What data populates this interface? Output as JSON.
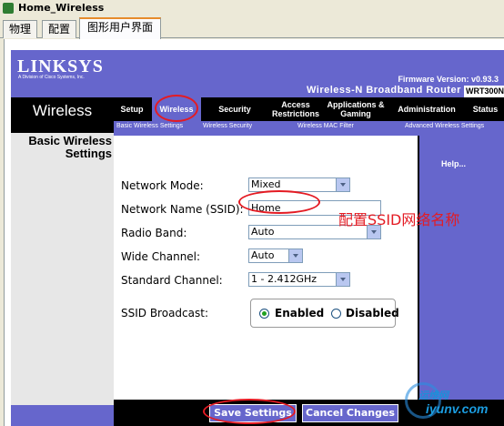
{
  "window": {
    "title": "Home_Wireless"
  },
  "tabs": [
    {
      "label": "物理"
    },
    {
      "label": "配置"
    },
    {
      "label": "图形用户界面"
    }
  ],
  "router": {
    "logo": "LINKSYS",
    "logo_sub": "A Division of Cisco Systems, Inc.",
    "firmware": "Firmware Version: v0.93.3",
    "product": "Wireless-N Broadband Router",
    "model": "WRT300N",
    "section": "Wireless",
    "nav": [
      {
        "label": "Setup"
      },
      {
        "label": "Wireless"
      },
      {
        "label": "Security"
      },
      {
        "label": "Access Restrictions"
      },
      {
        "label": "Applications & Gaming"
      },
      {
        "label": "Administration"
      },
      {
        "label": "Status"
      }
    ],
    "subnav": [
      {
        "label": "Basic Wireless Settings"
      },
      {
        "label": "Wireless Security"
      },
      {
        "label": "Wireless MAC Filter"
      },
      {
        "label": "Advanced Wireless Settings"
      }
    ],
    "left_title": "Basic Wireless Settings",
    "help": "Help...",
    "form": {
      "network_mode": {
        "label": "Network Mode:",
        "value": "Mixed"
      },
      "ssid": {
        "label": "Network Name (SSID):",
        "value": "Home"
      },
      "radio_band": {
        "label": "Radio Band:",
        "value": "Auto"
      },
      "wide_channel": {
        "label": "Wide Channel:",
        "value": "Auto"
      },
      "standard_channel": {
        "label": "Standard Channel:",
        "value": "1 - 2.412GHz"
      },
      "ssid_broadcast": {
        "label": "SSID Broadcast:",
        "enabled_label": "Enabled",
        "disabled_label": "Disabled",
        "selected": "Enabled"
      }
    },
    "buttons": {
      "save": "Save Settings",
      "cancel": "Cancel Changes"
    }
  },
  "annotation": {
    "text": "配置SSID网络名称",
    "color": "#e41b23"
  },
  "watermark": {
    "top": "运维网",
    "bottom": "iyunv.com"
  },
  "colors": {
    "accent": "#6666cc",
    "nav_bg": "#000000",
    "annotation": "#e41b23"
  }
}
